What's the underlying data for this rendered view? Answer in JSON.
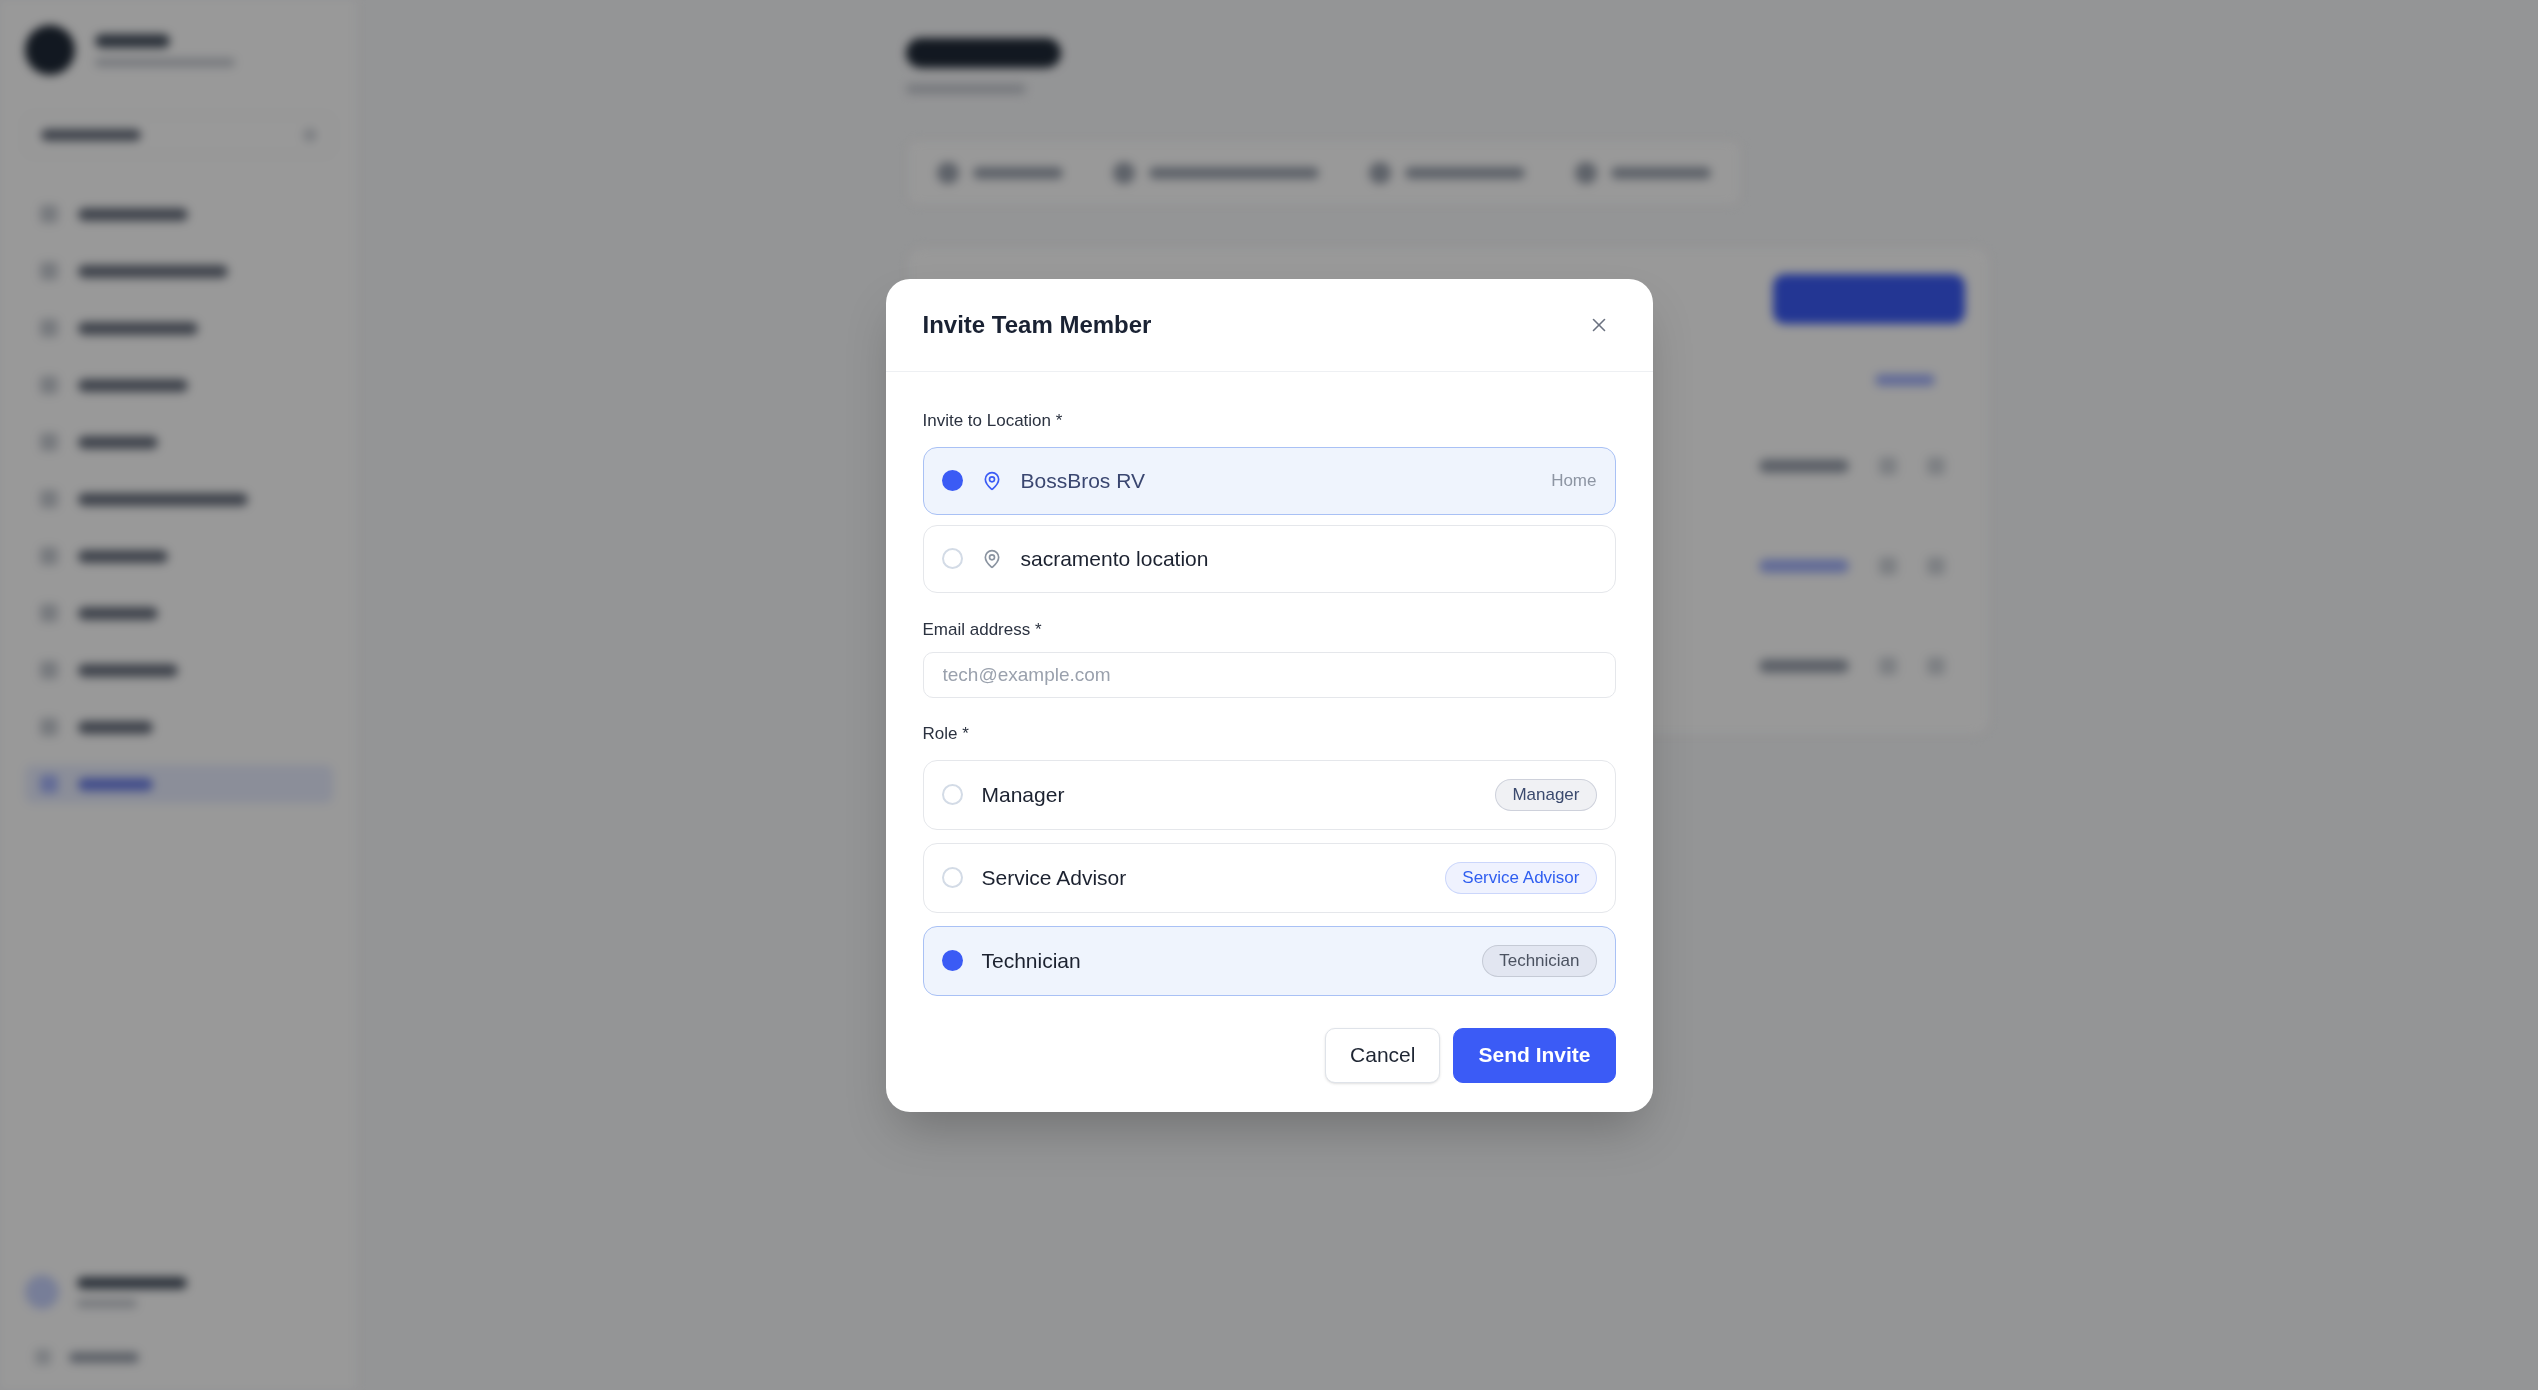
{
  "dialog": {
    "title": "Invite Team Member",
    "location": {
      "label": "Invite to Location *",
      "options": [
        {
          "name": "BossBros RV",
          "tag": "Home",
          "selected": true
        },
        {
          "name": "sacramento location",
          "selected": false
        }
      ]
    },
    "email": {
      "label": "Email address *",
      "placeholder": "tech@example.com"
    },
    "role": {
      "label": "Role *",
      "options": [
        {
          "name": "Manager",
          "badge": "Manager",
          "color": "#3b4a6e",
          "selected": false
        },
        {
          "name": "Service Advisor",
          "badge": "Service Advisor",
          "color": "#2f5ef0",
          "selected": false
        },
        {
          "name": "Technician",
          "badge": "Technician",
          "color": "#4b5260",
          "selected": true
        }
      ]
    },
    "buttons": [
      {
        "label": "Cancel",
        "kind": "secondary"
      },
      {
        "label": "Send Invite",
        "kind": "primary"
      }
    ]
  }
}
